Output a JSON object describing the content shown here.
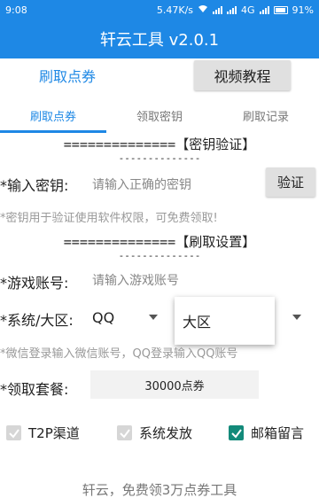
{
  "status": {
    "time": "9:08",
    "speed": "5.47K/s",
    "network": "4G",
    "battery": "91%"
  },
  "app": {
    "title": "轩云工具 v2.0.1"
  },
  "top_buttons": {
    "left": "刷取点券",
    "right": "视频教程"
  },
  "tabs": [
    "刷取点券",
    "领取密钥",
    "刷取记录"
  ],
  "key_section": {
    "title": "==============【密钥验证】",
    "dash": "--------------",
    "label": "*输入密钥:",
    "placeholder": "请输入正确的密钥",
    "verify": "验证",
    "hint": "*密钥用于验证使用软件权限，可免费领取!"
  },
  "settings_section": {
    "title": "==============【刷取设置】",
    "dash": "--------------",
    "account_label": "*游戏账号:",
    "account_placeholder": "请输入游戏账号",
    "system_label": "*系统/大区:",
    "system_value": "QQ",
    "region_popup": "大区",
    "hint": "*微信登录输入微信账号，QQ登录输入QQ账号",
    "package_label": "*领取套餐:",
    "package_value": "30000点券"
  },
  "checkboxes": [
    {
      "label": "T2P渠道",
      "checked": false
    },
    {
      "label": "系统发放",
      "checked": false
    },
    {
      "label": "邮箱留言",
      "checked": true
    }
  ],
  "footer": "轩云，免费领3万点券工具",
  "colors": {
    "primary": "#1e88e5",
    "checked": "#138a7a"
  }
}
